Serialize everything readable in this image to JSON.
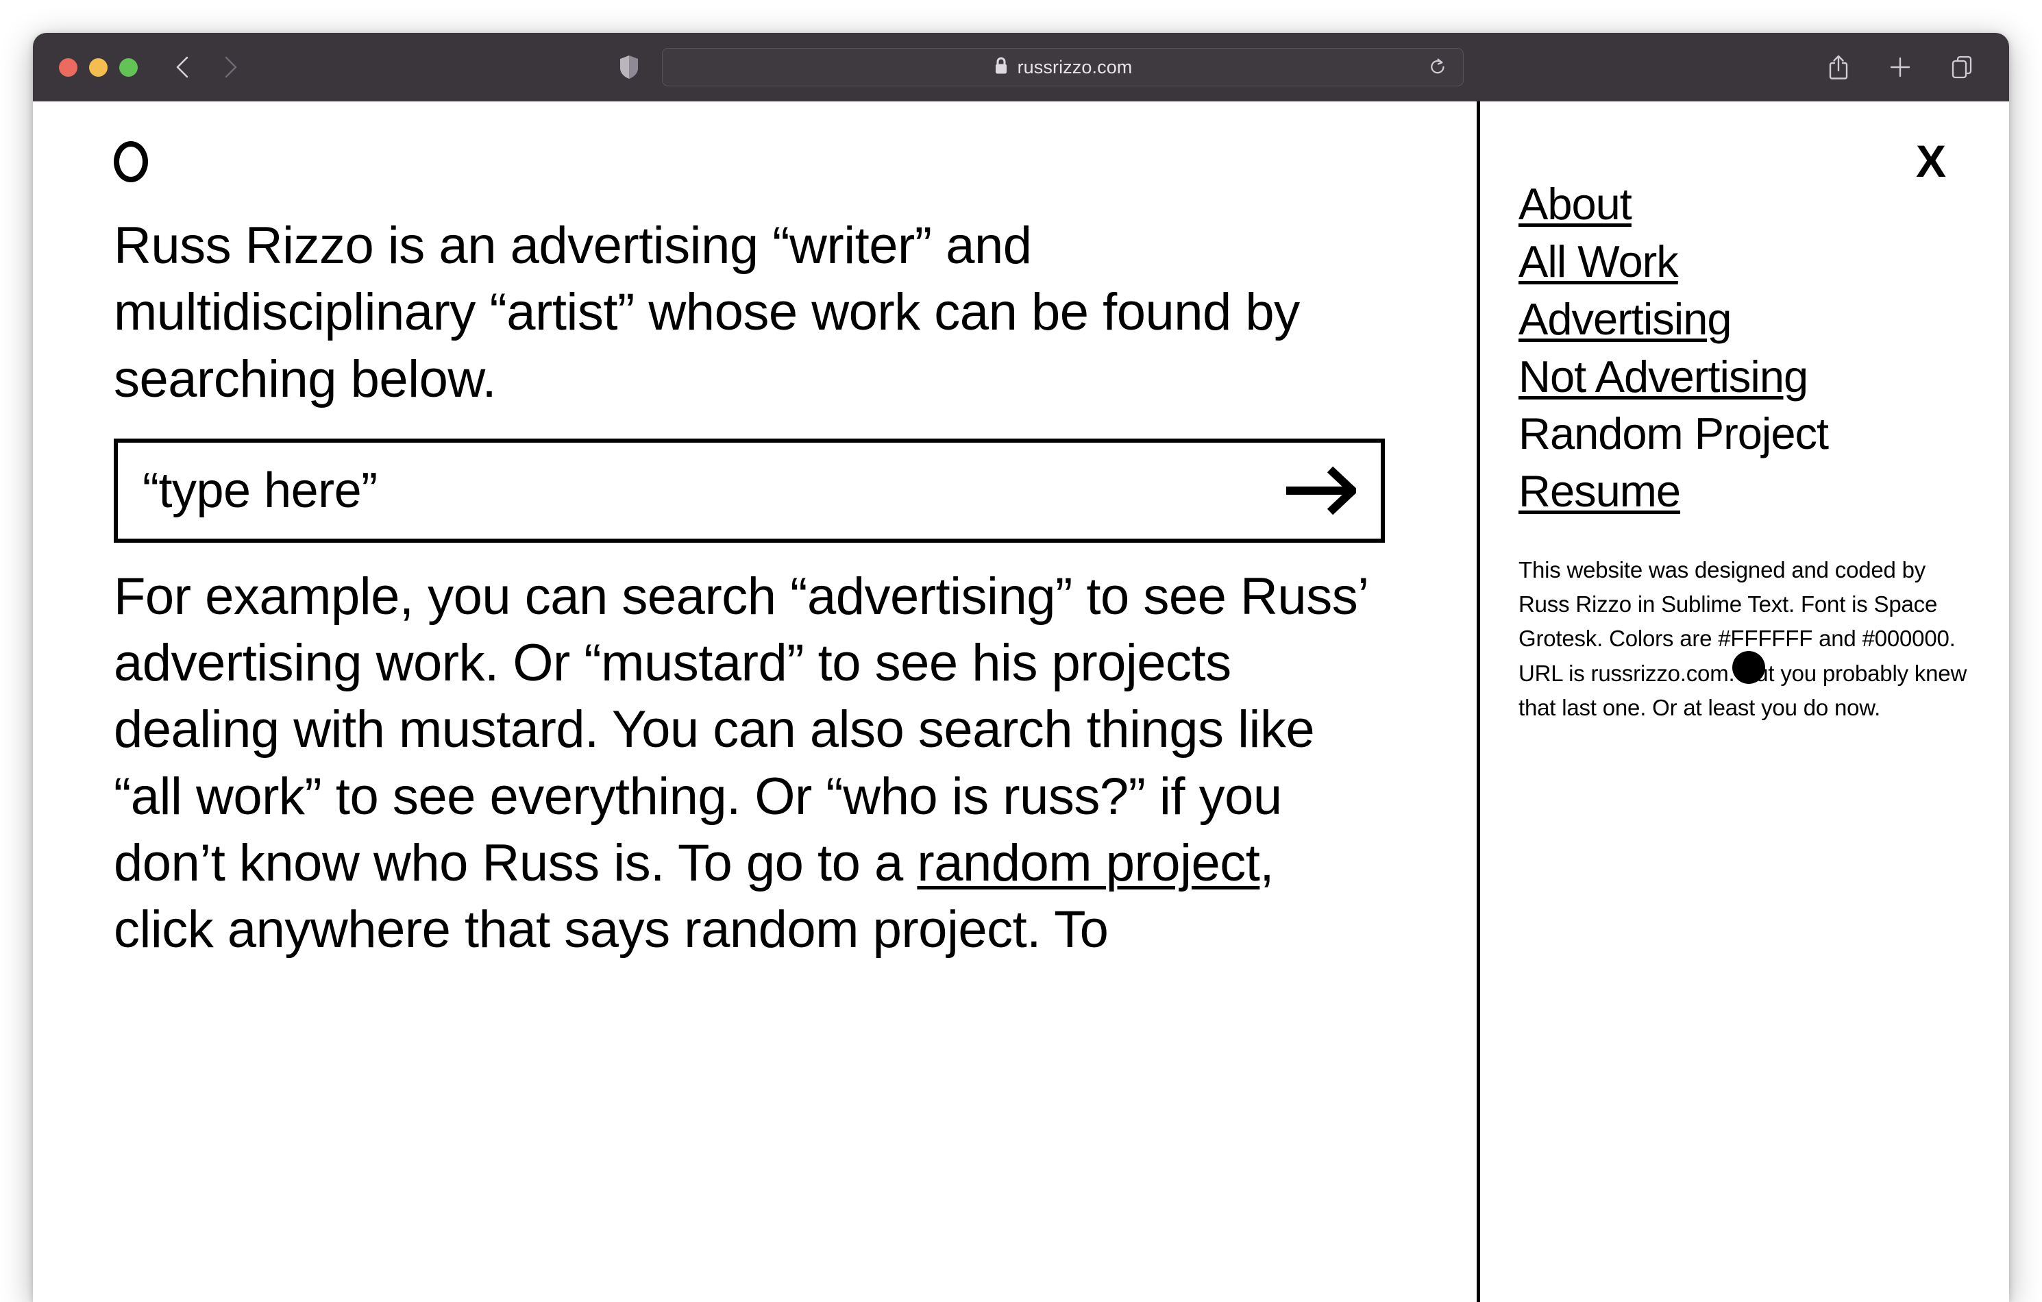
{
  "browser": {
    "traffic_lights": {
      "close_color": "#EC6A5E",
      "minimize_color": "#F4BD4F",
      "maximize_color": "#61C454"
    },
    "back_label": "Back",
    "forward_label": "Forward",
    "shield_label": "Tracking Protection",
    "url": "russrizzo.com",
    "lock_label": "Secure connection",
    "reload_label": "Reload",
    "share_label": "Share",
    "new_tab_label": "New Tab",
    "tabs_label": "Show Tab Overview",
    "toolbar_bg": "#3A363B"
  },
  "site": {
    "logo_mark": "circle-outline",
    "intro": "Russ Rizzo is an advertising “writer” and multidisciplinary “artist” whose work can be found by searching below.",
    "search": {
      "placeholder": "“type here”",
      "value": "",
      "submit_icon": "arrow-right-icon"
    },
    "body_before_link": "For example, you can search “advertising” to see Russ’ advertising work. Or “mustard” to see his projects dealing with mustard. You can also search things like “all work” to see everything. Or “who is russ?” if you don’t know who Russ is. To go to a ",
    "body_link": "random project",
    "body_after_link": ", click anywhere that says random project. To"
  },
  "sidebar": {
    "close_label": "X",
    "nav": [
      {
        "label": "About",
        "underlined": true
      },
      {
        "label": "All Work",
        "underlined": true
      },
      {
        "label": "Advertising",
        "underlined": true
      },
      {
        "label": "Not Advertising",
        "underlined": true
      },
      {
        "label": "Random Project",
        "underlined": false
      },
      {
        "label": "Resume",
        "underlined": true
      }
    ],
    "colophon": "This website was designed and coded by Russ Rizzo in Sublime Text. Font is Space Grotesk. Colors are #FFFFFF and #000000. URL is russrizzo.com. But you probably knew that last one. Or at least you do now."
  },
  "colors": {
    "page_bg": "#FFFFFF",
    "ink": "#000000"
  }
}
